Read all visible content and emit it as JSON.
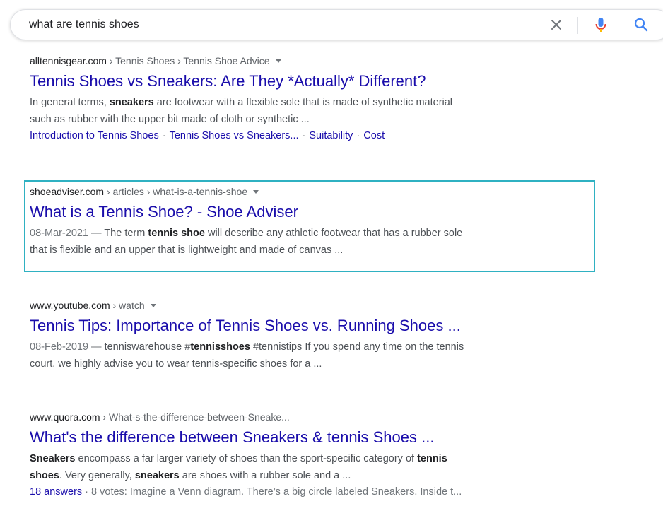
{
  "search": {
    "query": "what are tennis shoes"
  },
  "results": [
    {
      "site": "alltennisgear.com",
      "path": " › Tennis Shoes › Tennis Shoe Advice",
      "title": "Tennis Shoes vs Sneakers: Are They *Actually* Different?",
      "snippet_line1_pre": "In general terms, ",
      "snippet_line1_bold": "sneakers",
      "snippet_line1_post": " are footwear with a flexible sole that is made of synthetic material",
      "snippet_line2": "such as rubber with the upper bit made of cloth or synthetic ...",
      "sitelinks": [
        "Introduction to Tennis Shoes",
        "Tennis Shoes vs Sneakers...",
        "Suitability",
        "Cost"
      ]
    },
    {
      "site": "shoeadviser.com",
      "path": " › articles › what-is-a-tennis-shoe",
      "title": "What is a Tennis Shoe? - Shoe Adviser",
      "date": "08-Mar-2021 — ",
      "snippet_pre": "The term ",
      "snippet_bold": "tennis shoe",
      "snippet_post": " will describe any athletic footwear that has a rubber sole",
      "snippet_line2": "that is flexible and an upper that is lightweight and made of canvas ..."
    },
    {
      "site": "www.youtube.com",
      "path": " › watch",
      "title": "Tennis Tips: Importance of Tennis Shoes vs. Running Shoes ...",
      "date": "08-Feb-2019 — ",
      "snippet_pre": "tenniswarehouse #",
      "snippet_bold": "tennisshoes",
      "snippet_post": " #tennistips If you spend any time on the tennis",
      "snippet_line2": "court, we highly advise you to wear tennis-specific shoes for a ..."
    },
    {
      "site": "www.quora.com",
      "path": " › What-s-the-difference-between-Sneake...",
      "title": "What's the difference between Sneakers & tennis Shoes ...",
      "l1_bold1": "Sneakers",
      "l1_text": " encompass a far larger variety of shoes than the sport-specific category of ",
      "l1_bold2": "tennis",
      "l2_bold1": "shoes",
      "l2_text1": ". Very generally, ",
      "l2_bold2": "sneakers",
      "l2_text2": " are shoes with a rubber sole and a ...",
      "answers_link": "18 answers",
      "votes_text": " · 8 votes: Imagine a Venn diagram. There’s a big circle labeled Sneakers. Inside t..."
    }
  ],
  "colors": {
    "link": "#1a0dab",
    "highlight": "#2fb1c2",
    "mic_blue": "#4285f4",
    "mic_red": "#ea4335"
  }
}
